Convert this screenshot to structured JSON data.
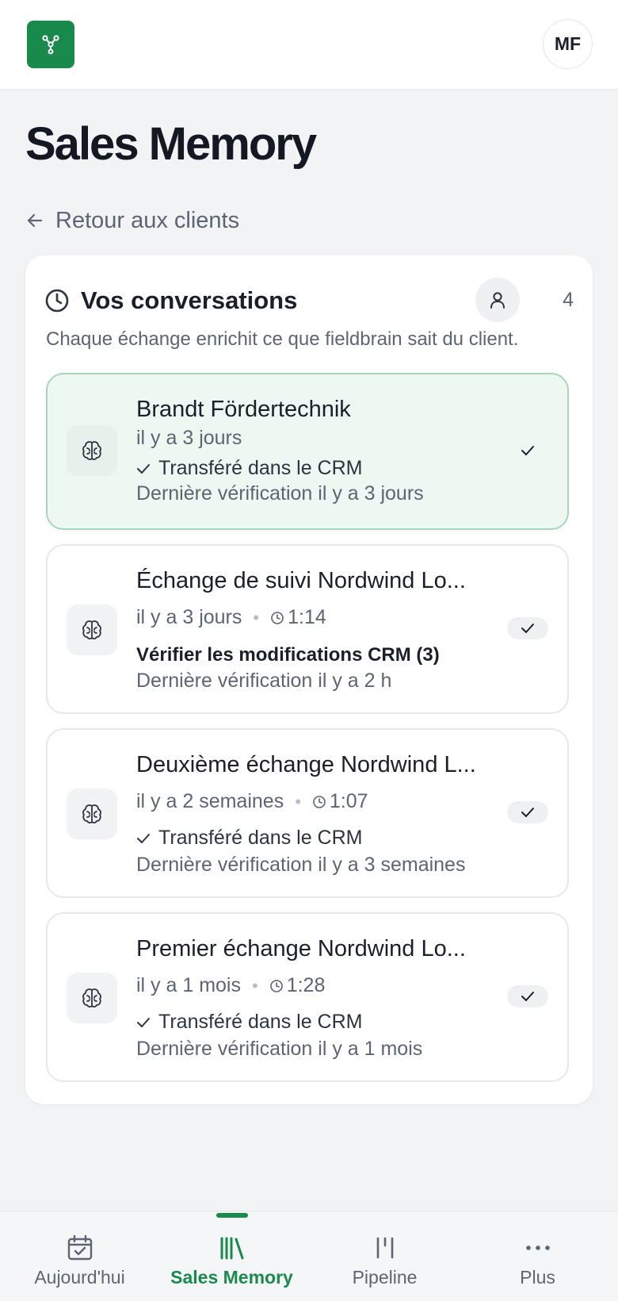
{
  "header": {
    "logo_icon": "network-tree-icon",
    "avatar_initials": "MF",
    "brand_color": "#1a8a4c"
  },
  "page": {
    "title": "Sales Memory",
    "back_label": "Retour aux clients"
  },
  "panel": {
    "title": "Vos conversations",
    "subtitle": "Chaque échange enrichit ce que fieldbrain sait du client.",
    "participant_count": "4"
  },
  "conversations": [
    {
      "title": "Brandt Fördertechnik",
      "when": "il y a 3 jours",
      "duration": "",
      "status": "Transféré dans le CRM",
      "verified": "Dernière vérification il y a 3 jours",
      "active": true
    },
    {
      "title": "Échange de suivi Nordwind Lo...",
      "when": "il y a 3 jours",
      "duration": "1:14",
      "status": "Vérifier les modifications CRM (3)",
      "verified": "Dernière vérification il y a 2 h",
      "active": false
    },
    {
      "title": "Deuxième échange Nordwind L...",
      "when": "il y a 2 semaines",
      "duration": "1:07",
      "status": "Transféré dans le CRM",
      "verified": "Dernière vérification il y a 3 semaines",
      "active": false
    },
    {
      "title": "Premier échange Nordwind Lo...",
      "when": "il y a 1 mois",
      "duration": "1:28",
      "status": "Transféré dans le CRM",
      "verified": "Dernière vérification il y a 1 mois",
      "active": false
    }
  ],
  "tabs": [
    {
      "label": "Aujourd'hui",
      "icon": "calendar-check-icon",
      "active": false
    },
    {
      "label": "Sales Memory",
      "icon": "books-icon",
      "active": true
    },
    {
      "label": "Pipeline",
      "icon": "pipeline-icon",
      "active": false
    },
    {
      "label": "Plus",
      "icon": "more-dots-icon",
      "active": false
    }
  ]
}
